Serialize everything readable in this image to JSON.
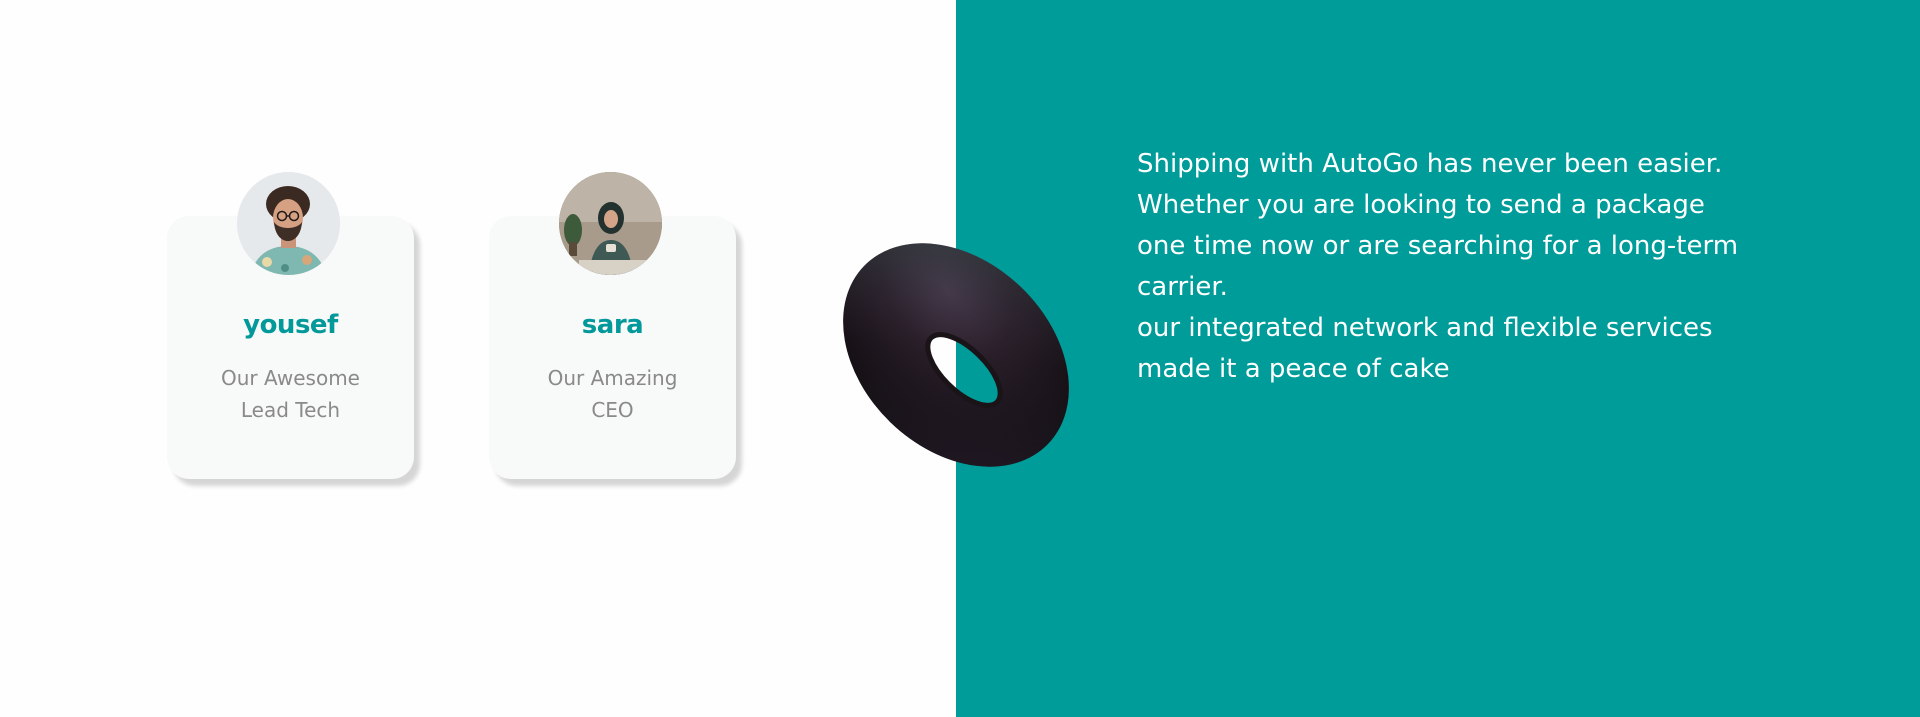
{
  "team": {
    "members": [
      {
        "name": "yousef",
        "role": "Our Awesome\nLead Tech",
        "avatar_icon": "avatar-photo"
      },
      {
        "name": "sara",
        "role": "Our Amazing\nCEO",
        "avatar_icon": "avatar-photo"
      }
    ]
  },
  "about": {
    "description": "Shipping with AutoGo has never been easier.\nWhether you are looking  to send a package\none time now or are searching for a long-term\ncarrier.\nour integrated network and flexible services\nmade it  a peace of cake"
  },
  "colors": {
    "accent": "#009c9a",
    "name_text": "#03989a",
    "role_text": "#8a8a8a",
    "card_bg": "#f8f9f9",
    "page_bg": "#fefefe"
  },
  "decoration": {
    "shape_icon": "torus-3d-icon"
  }
}
